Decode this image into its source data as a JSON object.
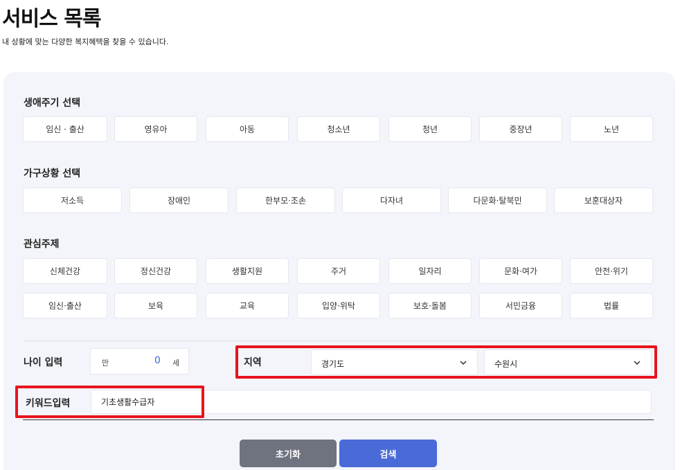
{
  "header": {
    "title": "서비스 목록",
    "subtitle": "내 상황에 맞는 다양한 복지혜택을 찾을 수 있습니다."
  },
  "lifecycle": {
    "title": "생애주기 선택",
    "items": [
      "임신 · 출산",
      "영유아",
      "아동",
      "청소년",
      "청년",
      "중장년",
      "노년"
    ]
  },
  "household": {
    "title": "가구상황 선택",
    "items": [
      "저소득",
      "장애인",
      "한부모·조손",
      "다자녀",
      "다문화·탈북민",
      "보훈대상자"
    ]
  },
  "interest": {
    "title": "관심주제",
    "items": [
      "신체건강",
      "정신건강",
      "생활지원",
      "주거",
      "일자리",
      "문화·여가",
      "안전·위기",
      "임신·출산",
      "보육",
      "교육",
      "입양·위탁",
      "보호·돌봄",
      "서민금융",
      "법률"
    ]
  },
  "age": {
    "label": "나이 입력",
    "prefix": "만",
    "value": "0",
    "suffix": "세"
  },
  "region": {
    "label": "지역",
    "province": "경기도",
    "city": "수원시"
  },
  "keyword": {
    "label": "키워드입력",
    "value": "기초생활수급자"
  },
  "buttons": {
    "reset": "초기화",
    "search": "검색"
  },
  "colors": {
    "highlight": "#e8141c",
    "search_button": "#4a6ad8",
    "reset_button": "#6f7380",
    "panel_bg": "#f3f5fb"
  }
}
